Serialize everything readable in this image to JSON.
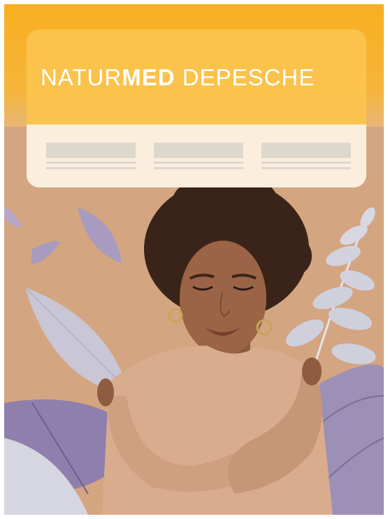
{
  "magazine": {
    "brand_part_1": "NATUR",
    "brand_part_2": "MED",
    "brand_part_3": " DEPESCHE"
  },
  "icons": {
    "leaves": "leaf-icon",
    "photo": "person-photo"
  },
  "colors": {
    "accent": "#f8b021",
    "background": "#d4a581",
    "card": "#fbeedd",
    "leaf_purple": "#9b8fb0",
    "leaf_grey": "#cfd1dc"
  }
}
